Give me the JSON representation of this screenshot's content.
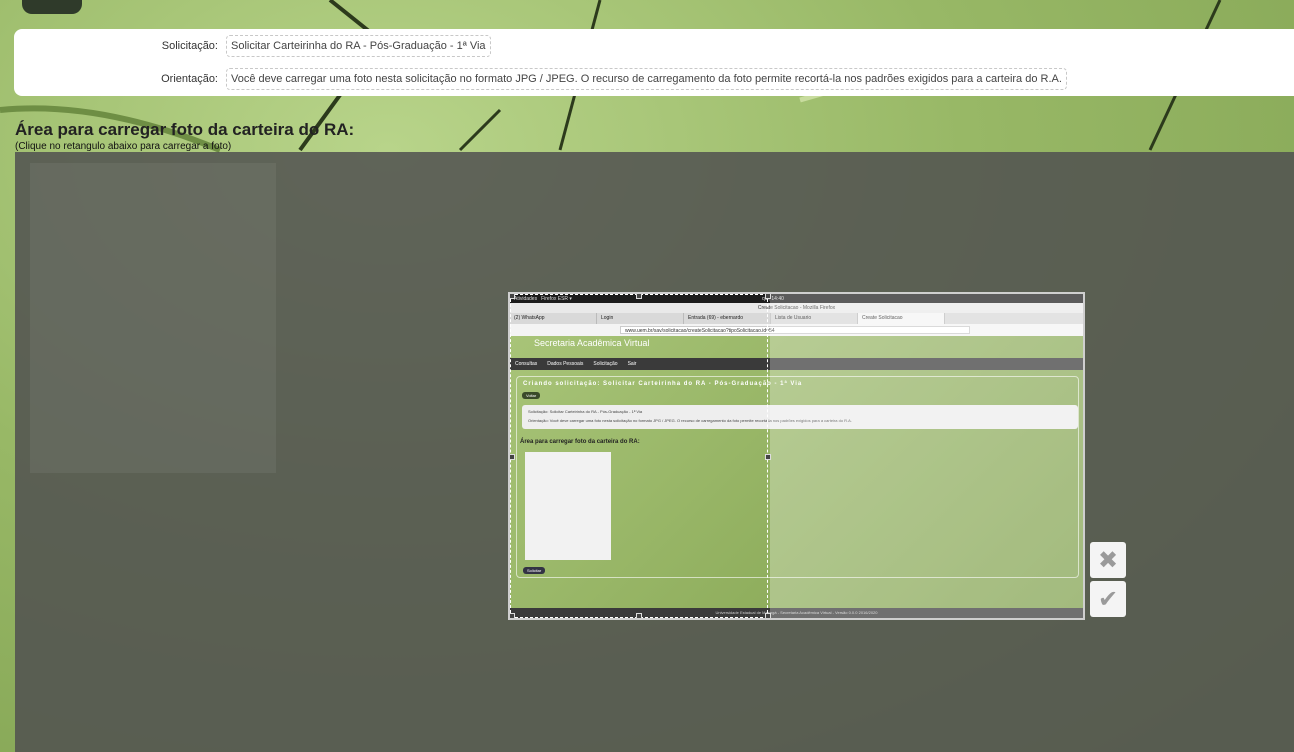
{
  "info": {
    "solicitacao_label": "Solicitação:",
    "solicitacao_value": "Solicitar Carteirinha do RA - Pós-Graduação - 1ª Via",
    "orientacao_label": "Orientação:",
    "orientacao_value": "Você deve carregar uma foto nesta solicitação no formato JPG / JPEG. O recurso de carregamento da foto permite recortá-la nos padrões exigidos para a carteira do R.A."
  },
  "upload": {
    "title": "Área para carregar foto da carteira do RA:",
    "hint": "(Clique no retangulo abaixo para carregar a foto)"
  },
  "cropper": {
    "cancel_icon": "close-icon",
    "confirm_icon": "checkmark-icon"
  },
  "screenshot": {
    "topbar_activities": "Atividades",
    "topbar_app": "Firefox ESR ▾",
    "topbar_time": "qui, 14:40",
    "window_title": "Create Solicitacao - Mozilla Firefox",
    "tabs": [
      "(2) WhatsApp",
      "Login",
      "Entrada (69) - ebernardo",
      "Lista de Usuario",
      "Create Solicitacao"
    ],
    "url": "www.uem.br/sav/solicitacao/createSolicitacao?tipoSolicitacao.id=54",
    "site_title": "Secretaria Acadêmica Virtual",
    "nav": [
      "Consultas",
      "Dados Pessoais",
      "Solicitação",
      "Sair"
    ],
    "card_heading": "Criando solicitação: Solicitar Carteirinha do RA - Pós-Graduação - 1ª Via",
    "voltar": "Voltar",
    "info_line1": "Solicitação:   Solicitar Carteirinha do RA - Pós-Graduação - 1ª Via",
    "info_line2": "Orientação:   Você deve carregar uma foto nesta solicitação no formato JPG / JPEG. O recurso de carregamento da foto permite recortá-la nos padrões exigidos para a carteira do R.A.",
    "area_title": "Área para carregar foto da carteira do RA:",
    "solicitar": "Solicitar",
    "footer": "Universidade Estadual de Maringá - Secretaria Acadêmica Virtual - Versão 0.0.0 2016/2020"
  }
}
